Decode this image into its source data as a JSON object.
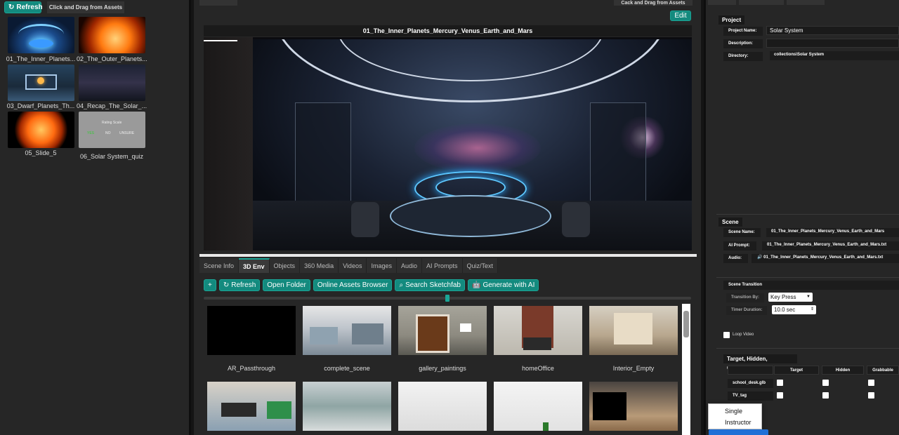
{
  "assets_panel": {
    "refresh_label": "Refresh",
    "drag_label": "Click and Drag from Assets",
    "items": [
      {
        "label": "01_The_Inner_Planets..."
      },
      {
        "label": "02_The_Outer_Planets..."
      },
      {
        "label": "03_Dwarf_Planets_Th..."
      },
      {
        "label": "04_Recap_The_Solar_..."
      },
      {
        "label": "05_Slide_5"
      },
      {
        "label": "06_Solar System_quiz"
      }
    ],
    "quiz_thumb": {
      "title": "Rating Scale",
      "yes": "YES",
      "no": "NO",
      "unsure": "UNSURE"
    }
  },
  "editor": {
    "top_right_label": "Cack and Drag from Assets",
    "edit_label": "Edit",
    "scene_title": "01_The_Inner_Planets_Mercury_Venus_Earth_and_Mars",
    "tabs": [
      {
        "label": "Scene Info"
      },
      {
        "label": "3D Env"
      },
      {
        "label": "Objects"
      },
      {
        "label": "360 Media"
      },
      {
        "label": "Videos"
      },
      {
        "label": "Images"
      },
      {
        "label": "Audio"
      },
      {
        "label": "AI Prompts"
      },
      {
        "label": "Quiz/Text"
      }
    ],
    "toolbar": {
      "add": "+",
      "refresh": "Refresh",
      "open_folder": "Open Folder",
      "online_assets": "Online Assets Browser",
      "search_sketchfab": "Search Sketchfab",
      "generate_ai": "Generate with AI"
    },
    "slider_value": 0.5,
    "environments": [
      {
        "label": "AR_Passthrough"
      },
      {
        "label": "complete_scene"
      },
      {
        "label": "gallery_paintings"
      },
      {
        "label": "homeOffice"
      },
      {
        "label": "Interior_Empty"
      }
    ]
  },
  "properties": {
    "project": {
      "section": "Project",
      "name_label": "Project Name:",
      "name_value": "Solar System",
      "description_label": "Description:",
      "description_value": "",
      "directory_label": "Directory:",
      "directory_value": "collections\\Solar System"
    },
    "scene": {
      "section": "Scene",
      "name_label": "Scene Name:",
      "name_value": "01_The_Inner_Planets_Mercury_Venus_Earth_and_Mars",
      "ai_prompt_label": "AI Prompt:",
      "ai_prompt_value": "01_The_Inner_Planets_Mercury_Venus_Earth_and_Mars.txt",
      "audio_label": "Audio:",
      "audio_value": "01_The_Inner_Planets_Mercury_Venus_Earth_and_Mars.txt"
    },
    "transition": {
      "section": "Scene Transition",
      "transition_label": "Transition By:",
      "transition_value": "Key Press",
      "timer_label": "Timer Duration:",
      "timer_value": "10.0 sec",
      "loop_label": "Loop Video"
    },
    "thg": {
      "section": "Target, Hidden, Grabbable",
      "col_target": "Target",
      "col_hidden": "Hidden",
      "col_grabbable": "Grabbable",
      "rows": [
        {
          "name": "school_desk.glb"
        },
        {
          "name": "TV_tag"
        }
      ]
    },
    "mode_menu": {
      "options": [
        "Single",
        "Instructor"
      ]
    }
  },
  "colors": {
    "accent": "#138a7e",
    "panel": "#262626",
    "selection": "#1f6fd6"
  }
}
